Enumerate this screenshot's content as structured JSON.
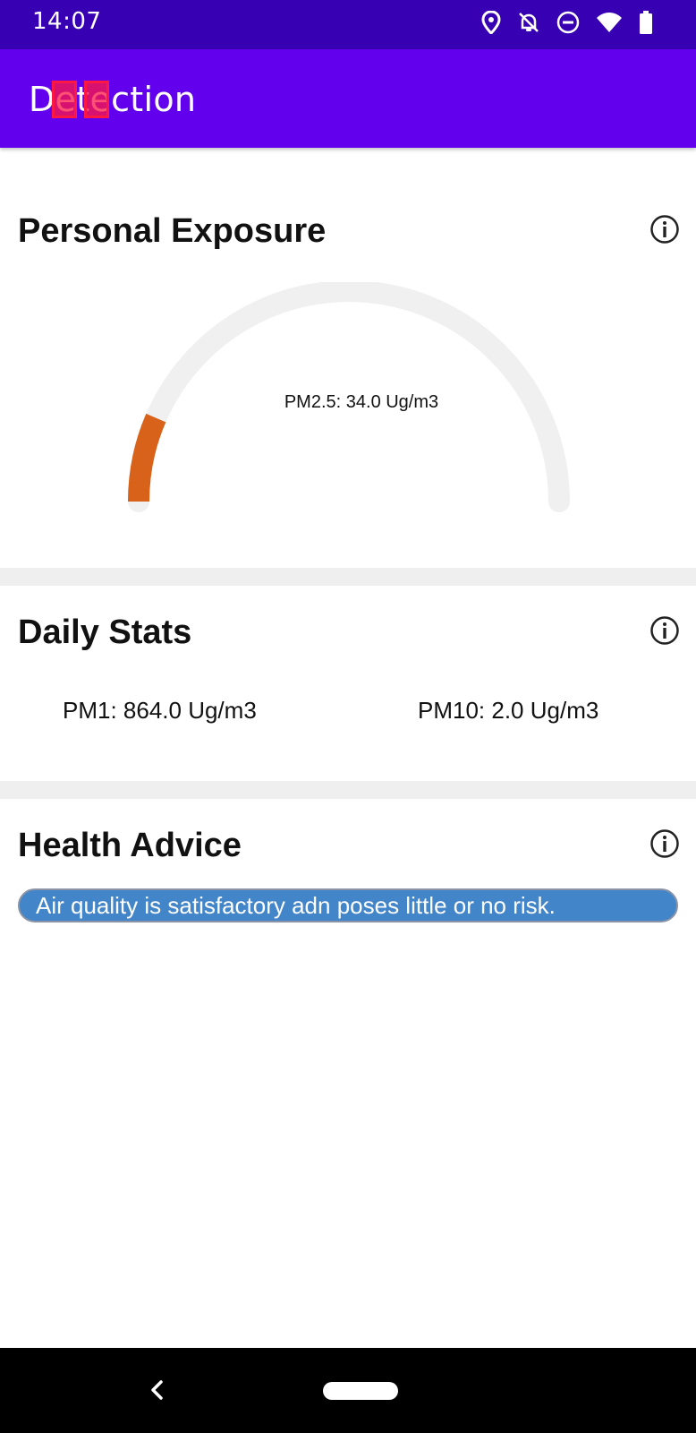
{
  "status_bar": {
    "time": "14:07",
    "icons": [
      "location-icon",
      "notifications-off-icon",
      "do-not-disturb-icon",
      "wifi-icon",
      "battery-icon"
    ]
  },
  "app_bar": {
    "title": "Detection"
  },
  "personal_exposure": {
    "title": "Personal Exposure",
    "gauge_label": "PM2.5:  34.0  Ug/m3",
    "gauge_fill_fraction": 0.13,
    "gauge_color": "#d9621a",
    "gauge_track_color": "#f0f0f0"
  },
  "daily_stats": {
    "title": "Daily Stats",
    "pm1": "PM1:  864.0  Ug/m3",
    "pm10": "PM10:  2.0  Ug/m3"
  },
  "health_advice": {
    "title": "Health Advice",
    "message": "Air quality is satisfactory adn poses little or no risk.",
    "color": "#4285c8"
  },
  "colors": {
    "status_bar": "#3700b3",
    "app_bar": "#6200ee",
    "divider": "#efefef"
  }
}
